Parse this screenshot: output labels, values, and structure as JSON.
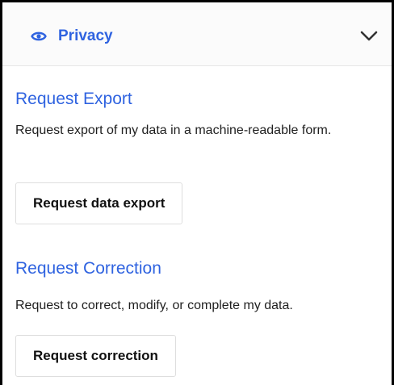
{
  "header": {
    "icon": "eye-icon",
    "title": "Privacy",
    "toggle_icon": "chevron-down-icon"
  },
  "sections": [
    {
      "title": "Request Export",
      "description": "Request export of my data in a machine-readable form.",
      "button_label": "Request data export"
    },
    {
      "title": "Request Correction",
      "description": "Request to correct, modify, or complete my data.",
      "button_label": "Request correction"
    }
  ],
  "colors": {
    "accent": "#2f63e0",
    "header_bg": "#fbfbfb",
    "text": "#1f1f1f",
    "button_border": "#dedede"
  }
}
